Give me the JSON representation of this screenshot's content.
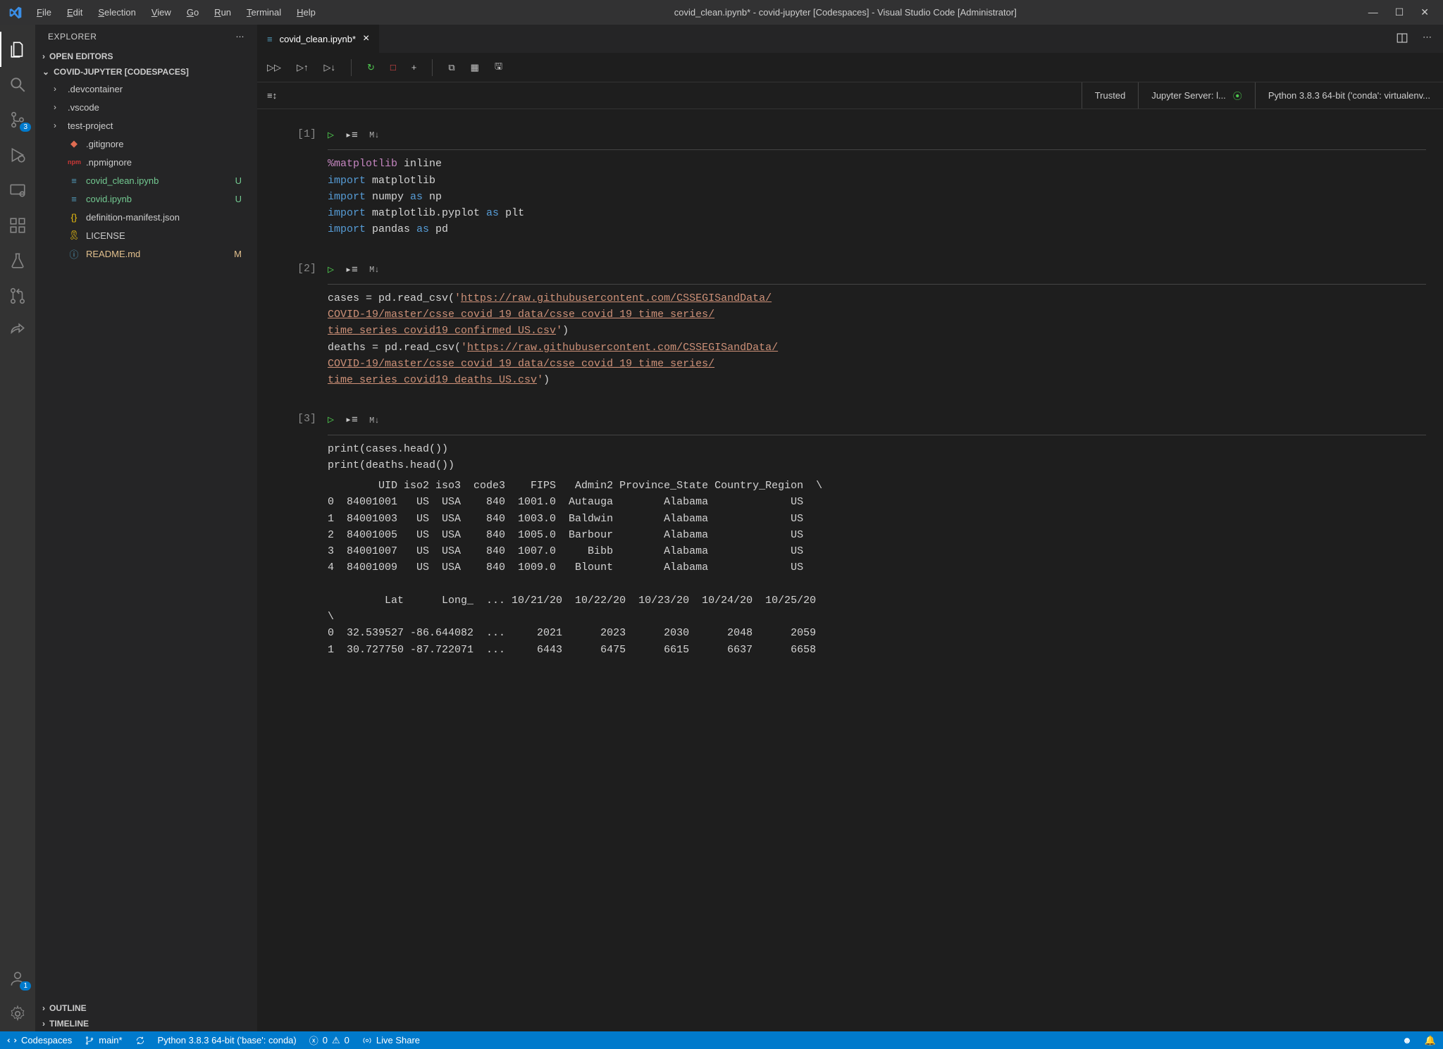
{
  "menubar": {
    "file": "File",
    "edit": "Edit",
    "selection": "Selection",
    "view": "View",
    "go": "Go",
    "run": "Run",
    "terminal": "Terminal",
    "help": "Help"
  },
  "title": "covid_clean.ipynb* - covid-jupyter [Codespaces] - Visual Studio Code [Administrator]",
  "activity": {
    "scm_badge": "3",
    "accounts_badge": "1"
  },
  "sidebar": {
    "title": "EXPLORER",
    "open_editors": "OPEN EDITORS",
    "workspace": "COVID-JUPYTER [CODESPACES]",
    "folders": [
      {
        "name": ".devcontainer"
      },
      {
        "name": ".vscode"
      },
      {
        "name": "test-project"
      }
    ],
    "files": [
      {
        "name": ".gitignore",
        "icon": "git",
        "status": ""
      },
      {
        "name": ".npmignore",
        "icon": "npm",
        "status": ""
      },
      {
        "name": "covid_clean.ipynb",
        "icon": "nb",
        "status": "U",
        "class": "green"
      },
      {
        "name": "covid.ipynb",
        "icon": "nb",
        "status": "U",
        "class": "green"
      },
      {
        "name": "definition-manifest.json",
        "icon": "json",
        "status": ""
      },
      {
        "name": "LICENSE",
        "icon": "cert",
        "status": ""
      },
      {
        "name": "README.md",
        "icon": "info",
        "status": "M",
        "class": "yellow"
      }
    ],
    "outline": "OUTLINE",
    "timeline": "TIMELINE"
  },
  "tab": {
    "label": "covid_clean.ipynb*"
  },
  "nb_status": {
    "trusted": "Trusted",
    "server": "Jupyter Server: l...",
    "kernel": "Python 3.8.3 64-bit ('conda': virtualenv..."
  },
  "cells": [
    {
      "prompt": "[1]",
      "code_html": "<span class='k-mag'>%matplotlib</span> inline\n<span class='k-key'>import</span> matplotlib\n<span class='k-key'>import</span> numpy <span class='k-key'>as</span> np\n<span class='k-key'>import</span> matplotlib.pyplot <span class='k-key'>as</span> plt\n<span class='k-key'>import</span> pandas <span class='k-key'>as</span> pd"
    },
    {
      "prompt": "[2]",
      "code_html": "cases = pd.read_csv(<span class='k-str'>'</span><span class='k-url'>https://raw.githubusercontent.com/CSSEGISandData/</span>\n<span class='k-url'>COVID-19/master/csse_covid_19_data/csse_covid_19_time_series/</span>\n<span class='k-url'>time_series_covid19_confirmed_US.csv</span><span class='k-str'>'</span>)\ndeaths = pd.read_csv(<span class='k-str'>'</span><span class='k-url'>https://raw.githubusercontent.com/CSSEGISandData/</span>\n<span class='k-url'>COVID-19/master/csse_covid_19_data/csse_covid_19_time_series/</span>\n<span class='k-url'>time_series_covid19_deaths_US.csv</span><span class='k-str'>'</span>)"
    },
    {
      "prompt": "[3]",
      "code_html": "print(cases.head())\nprint(deaths.head())",
      "output": "        UID iso2 iso3  code3    FIPS   Admin2 Province_State Country_Region  \\\n0  84001001   US  USA    840  1001.0  Autauga        Alabama             US\n1  84001003   US  USA    840  1003.0  Baldwin        Alabama             US\n2  84001005   US  USA    840  1005.0  Barbour        Alabama             US\n3  84001007   US  USA    840  1007.0     Bibb        Alabama             US\n4  84001009   US  USA    840  1009.0   Blount        Alabama             US\n\n         Lat      Long_  ... 10/21/20  10/22/20  10/23/20  10/24/20  10/25/20\n\\\n0  32.539527 -86.644082  ...     2021      2023      2030      2048      2059\n1  30.727750 -87.722071  ...     6443      6475      6615      6637      6658"
    }
  ],
  "statusbar": {
    "codespaces": "Codespaces",
    "branch": "main*",
    "python": "Python 3.8.3 64-bit ('base': conda)",
    "errors": "0",
    "warnings": "0",
    "liveshare": "Live Share"
  },
  "icons": {
    "md": "M↓"
  }
}
